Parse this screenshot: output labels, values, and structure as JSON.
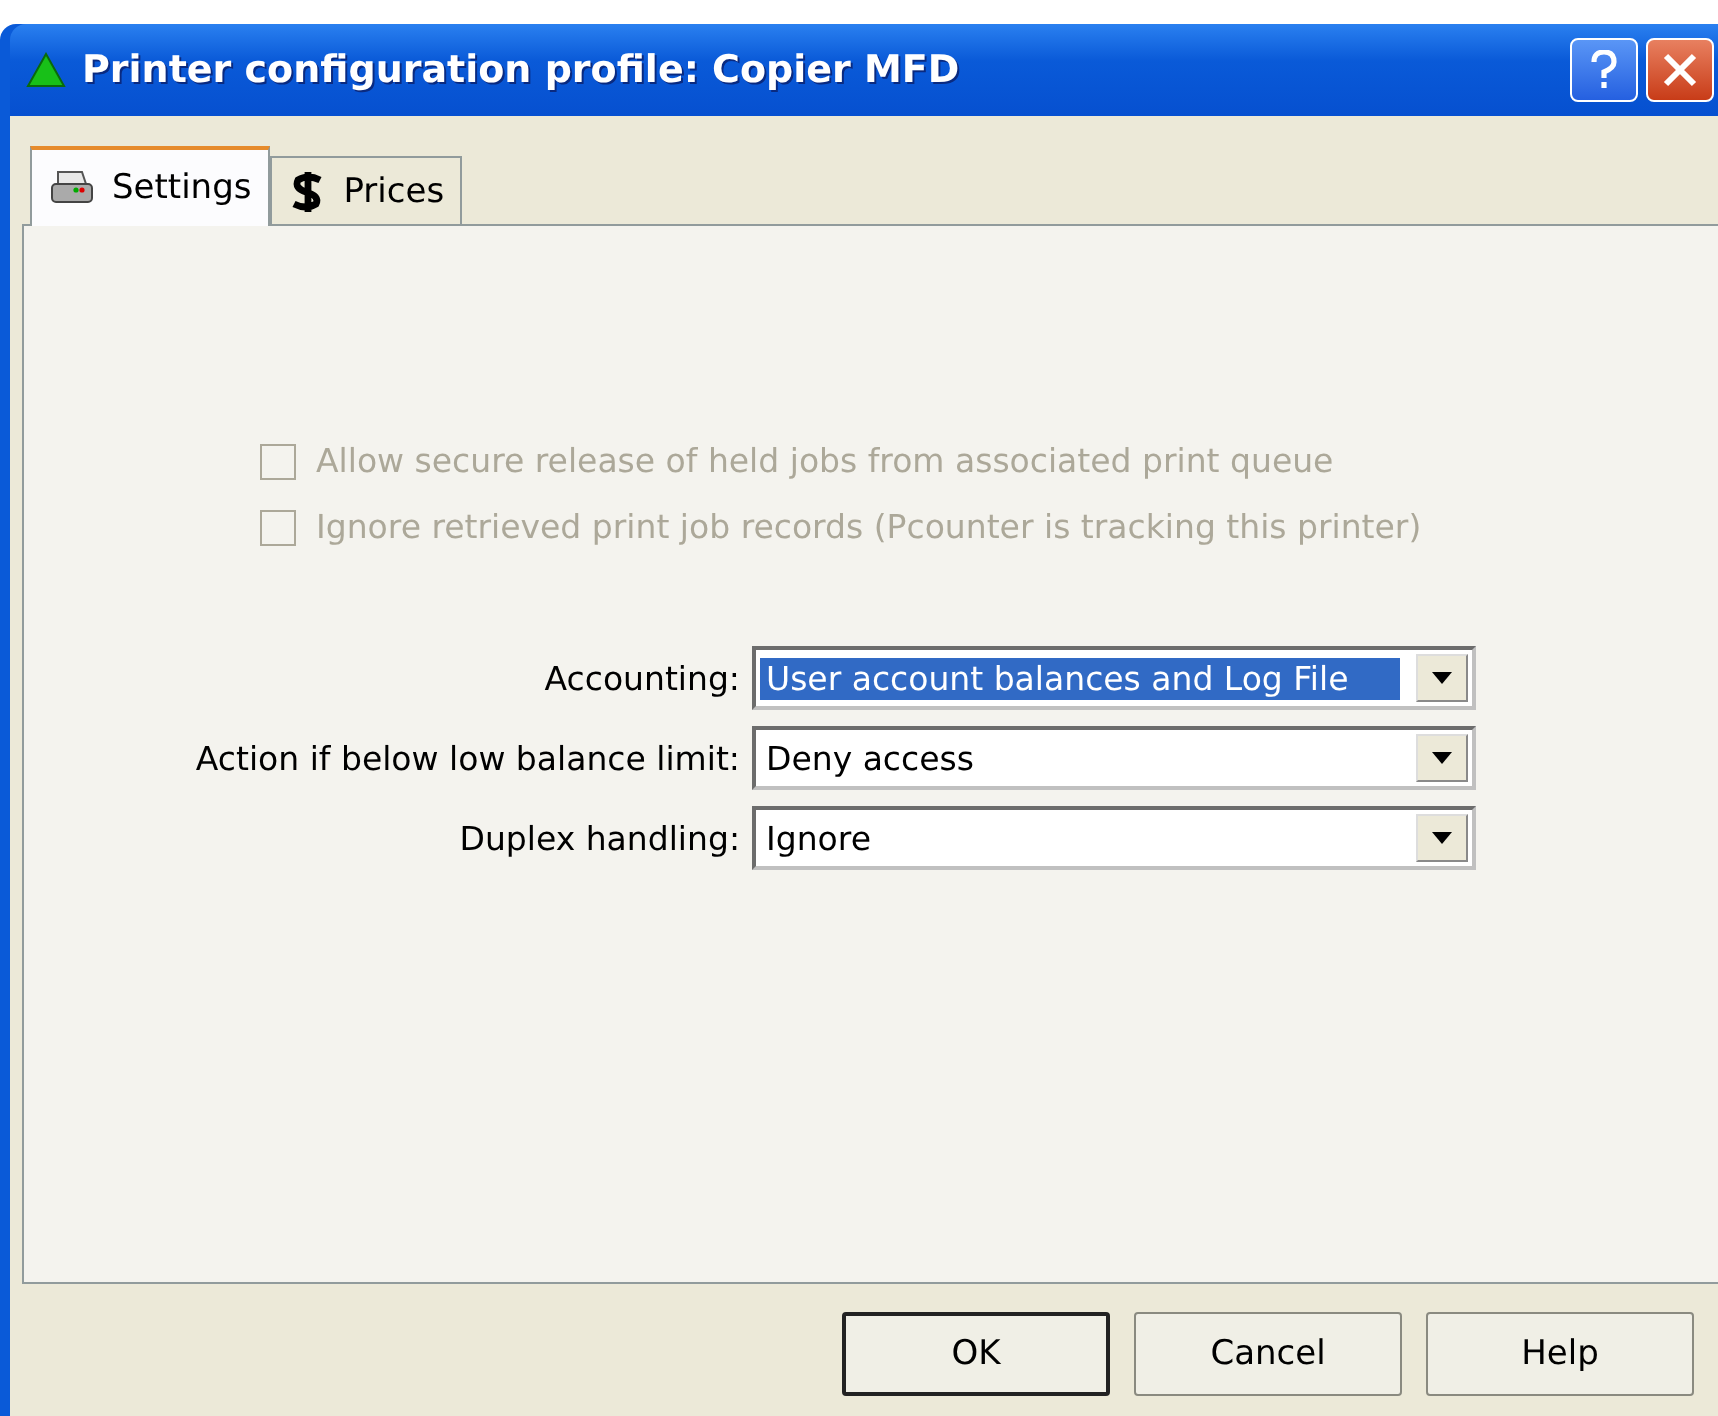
{
  "window": {
    "title": "Printer configuration profile: Copier MFD"
  },
  "tabs": [
    {
      "label": "Settings",
      "kind": "printer",
      "selected": true
    },
    {
      "label": "Prices",
      "kind": "money",
      "selected": false
    }
  ],
  "checkboxes": [
    {
      "label": "Allow secure release of held jobs from associated print queue",
      "checked": false,
      "disabled": true
    },
    {
      "label": "Ignore retrieved print job records (Pcounter is tracking this printer)",
      "checked": false,
      "disabled": true
    }
  ],
  "fields": [
    {
      "label": "Accounting:",
      "value": "User account balances and Log File",
      "focused": true
    },
    {
      "label": "Action if below low balance limit:",
      "value": "Deny access",
      "focused": false
    },
    {
      "label": "Duplex handling:",
      "value": "Ignore",
      "focused": false
    }
  ],
  "buttons": [
    {
      "label": "OK",
      "default": true
    },
    {
      "label": "Cancel",
      "default": false
    },
    {
      "label": "Help",
      "default": false
    }
  ]
}
